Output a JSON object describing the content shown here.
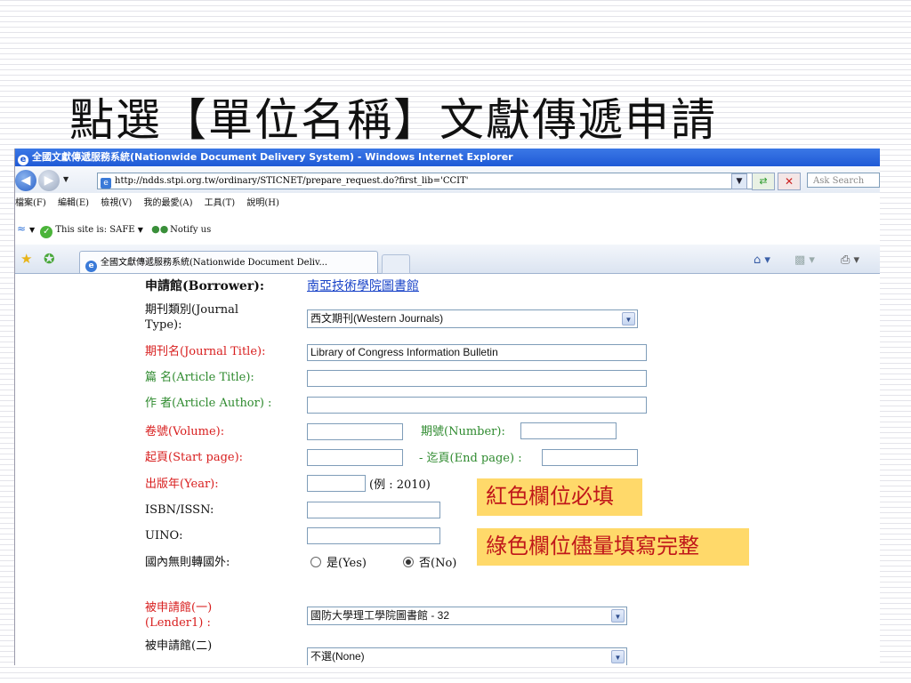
{
  "slide": {
    "title": "點選【單位名稱】文獻傳遞申請"
  },
  "browser": {
    "window_title": "全國文獻傳遞服務系統(Nationwide Document Delivery System) - Windows Internet Explorer",
    "address": "http://ndds.stpi.org.tw/ordinary/STICNET/prepare_request.do?first_lib='CCIT'",
    "search_placeholder": "Ask Search",
    "menu": [
      "檔案(F)",
      "編輯(E)",
      "檢視(V)",
      "我的最愛(A)",
      "工具(T)",
      "說明(H)"
    ],
    "safe_text": "This site is: SAFE",
    "notify_text": "Notify us",
    "tab_label": "全國文獻傳遞服務系統(Nationwide Document Deliv..."
  },
  "form": {
    "borrower_label": "申請館(Borrower):",
    "borrower_value": "南亞技術學院圖書館",
    "journal_type_label_1": "期刊類別(Journal",
    "journal_type_label_2": "Type):",
    "journal_type_value": "西文期刊(Western Journals)",
    "journal_title_label": "期刊名(Journal Title):",
    "journal_title_value": "Library of Congress Information Bulletin",
    "article_title_label": "篇 名(Article Title):",
    "article_title_value": "",
    "article_author_label": "作 者(Article Author) :",
    "article_author_value": "",
    "volume_label": "卷號(Volume):",
    "volume_value": "",
    "number_label": "期號(Number):",
    "number_value": "",
    "start_page_label": "起頁(Start page):",
    "start_page_value": "",
    "end_page_label": "- 迄頁(End page) :",
    "end_page_value": "",
    "year_label": "出版年(Year):",
    "year_value": "",
    "year_example": "(例 : 2010)",
    "isbn_label": "ISBN/ISSN:",
    "isbn_value": "",
    "uino_label": "UINO:",
    "uino_value": "",
    "foreign_label": "國內無則轉國外:",
    "yes_label": "是(Yes)",
    "no_label": "否(No)",
    "foreign_selected": "No",
    "lender1_label_1": "被申請館(一)",
    "lender1_label_2": "(Lender1) :",
    "lender1_value": "國防大學理工學院圖書館 - 32",
    "lender2_label_1": "被申請館(二)",
    "lender2_value": "不選(None)"
  },
  "callouts": {
    "red_required": "紅色欄位必填",
    "green_recommended": "綠色欄位儘量填寫完整"
  },
  "colors": {
    "required": "#d81e1e",
    "recommended": "#2e8a2e",
    "callout_bg": "#ffd96a",
    "link": "#1a44c8"
  }
}
